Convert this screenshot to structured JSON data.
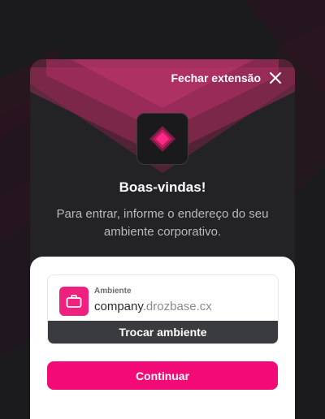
{
  "header": {
    "close_label": "Fechar extensão",
    "close_icon": "close-icon"
  },
  "logo": {
    "icon": "drozbase-diamond-logo"
  },
  "welcome": {
    "title": "Boas-vindas!",
    "subtitle": "Para entrar, informe o endereço do seu ambiente corporativo."
  },
  "environment": {
    "label": "Ambiente",
    "value_prefix": "company",
    "value_suffix": ".drozbase.cx",
    "icon": "briefcase-icon",
    "switch_label": "Trocar ambiente"
  },
  "actions": {
    "continue_label": "Continuar"
  },
  "colors": {
    "accent": "#f20a77",
    "background": "#1b1b1d",
    "card": "#232325",
    "switch_button": "#3a3b3e"
  }
}
